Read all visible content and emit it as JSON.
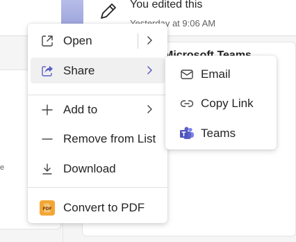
{
  "background": {
    "activity_title": "You edited this",
    "activity_time": "Yesterday at 9:06 AM",
    "section_heading": "Microsoft Teams",
    "left_fragment": "e"
  },
  "menu": {
    "items": [
      {
        "label": "Open",
        "icon": "open-external-icon"
      },
      {
        "label": "Share",
        "icon": "share-icon"
      },
      {
        "label": "Add to",
        "icon": "plus-icon"
      },
      {
        "label": "Remove from List",
        "icon": "minus-icon"
      },
      {
        "label": "Download",
        "icon": "download-icon"
      },
      {
        "label": "Convert to PDF",
        "icon": "pdf-icon"
      }
    ]
  },
  "submenu": {
    "items": [
      {
        "label": "Email",
        "icon": "mail-icon"
      },
      {
        "label": "Copy Link",
        "icon": "link-icon"
      },
      {
        "label": "Teams",
        "icon": "teams-icon"
      }
    ]
  },
  "colors": {
    "accent": "#5b5fc7",
    "pdf_badge": "#f2a735"
  }
}
